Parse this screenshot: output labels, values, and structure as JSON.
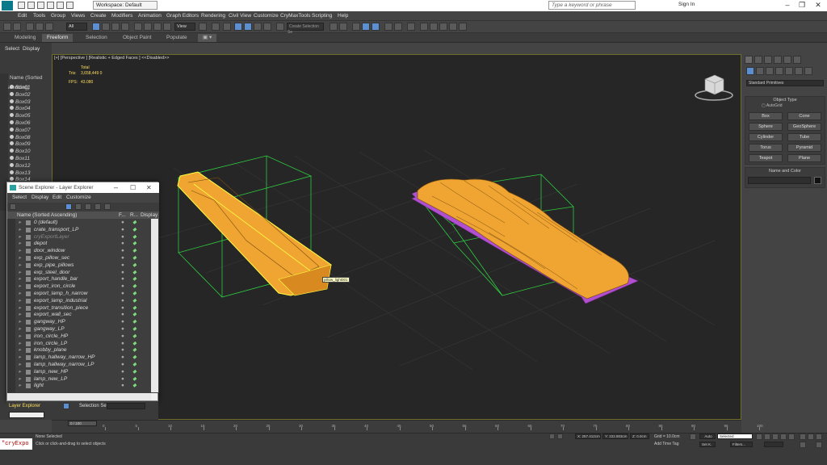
{
  "title_bar": {
    "workspace": "Workspace: Default",
    "search_placeholder": "Type a keyword or phrase",
    "sign_in": "Sign In"
  },
  "menu": [
    "Edit",
    "Tools",
    "Group",
    "Views",
    "Create",
    "Modifiers",
    "Animation",
    "Graph Editors",
    "Rendering",
    "Civil View",
    "Customize",
    "CryMaxTools",
    "Scripting",
    "Help"
  ],
  "toolbar": {
    "filter_value": "All",
    "view_value": "View",
    "selection_set": "Create Selection Se"
  },
  "ribbon_tabs": [
    "Modeling",
    "Freeform",
    "Selection",
    "Object Paint",
    "Populate"
  ],
  "left_strip": {
    "tabs": [
      "Select",
      "Display"
    ],
    "header": "Name (Sorted Ascending)",
    "items": [
      "Box01",
      "Box02",
      "Box03",
      "Box04",
      "Box05",
      "Box06",
      "Box07",
      "Box08",
      "Box09",
      "Box10",
      "Box11",
      "Box12",
      "Box13",
      "Box14"
    ]
  },
  "viewport": {
    "label": "[+] [Perspective ] [Realistic + Edged Faces ] <<Disabled>>",
    "stats_total_label": "Total",
    "tris_label": "Tris:",
    "tris_value": "3,658,449 0",
    "fps_label": "FPS:",
    "fps_value": "43.080",
    "tooltip": "pillow_light001"
  },
  "command_panel": {
    "dropdown": "Standard Primitives",
    "object_type_header": "Object Type",
    "autogrid": "AutoGrid",
    "buttons": [
      "Box",
      "Cone",
      "Sphere",
      "GeoSphere",
      "Cylinder",
      "Tube",
      "Torus",
      "Pyramid",
      "Teapot",
      "Plane"
    ],
    "name_color_header": "Name and Color"
  },
  "scene_explorer": {
    "title": "Scene Explorer - Layer Explorer",
    "menu": [
      "Select",
      "Display",
      "Edit",
      "Customize"
    ],
    "col_name": "Name (Sorted Ascending)",
    "col_frozen": "F...",
    "col_render": "R...",
    "col_display": "Display",
    "rows": [
      "0 (default)",
      "crate_transport_LP",
      "cryExportLayer",
      "depot",
      "door_window",
      "exp_pillow_sec",
      "exp_pipe_pillows",
      "exp_steel_door",
      "export_handle_bar",
      "export_iron_circle",
      "export_lamp_h_narrow",
      "export_lamp_industrial",
      "export_transition_piece",
      "export_wall_sec",
      "gangway_HP",
      "gangway_LP",
      "iron_circle_HP",
      "iron_circle_LP",
      "knobby_plane",
      "lamp_hallway_narrow_HP",
      "lamp_hallway_narrow_LP",
      "lamp_new_HP",
      "lamp_new_LP",
      "light"
    ]
  },
  "bottom_left": {
    "layer_explorer": "Layer Explorer",
    "selection_set": "Selection Set:"
  },
  "timeline": {
    "frame": "0 / 100",
    "ticks": [
      "0",
      "5",
      "10",
      "15",
      "20",
      "25",
      "30",
      "35",
      "40",
      "45",
      "50",
      "55",
      "60",
      "65",
      "70",
      "75",
      "80",
      "85",
      "90",
      "95",
      "100"
    ]
  },
  "status": {
    "maxscript": "\"cryExpo",
    "line1": "None Selected",
    "line2": "Click or click-and-drag to select objects",
    "x": "X: 257.412cm",
    "y": "Y: 222.803cm",
    "z": "Z: 0.0cm",
    "grid": "Grid = 10.0cm",
    "add_time_tag": "Add Time Tag",
    "auto": "Auto",
    "selected": "Selected",
    "set_k": "Set K.",
    "filters": "Filters..."
  },
  "colors": {
    "object_orange": "#f0a532",
    "object_purple": "#b050d0",
    "bbox_green": "#2ecc40",
    "selection_yellow": "#ffff40"
  }
}
